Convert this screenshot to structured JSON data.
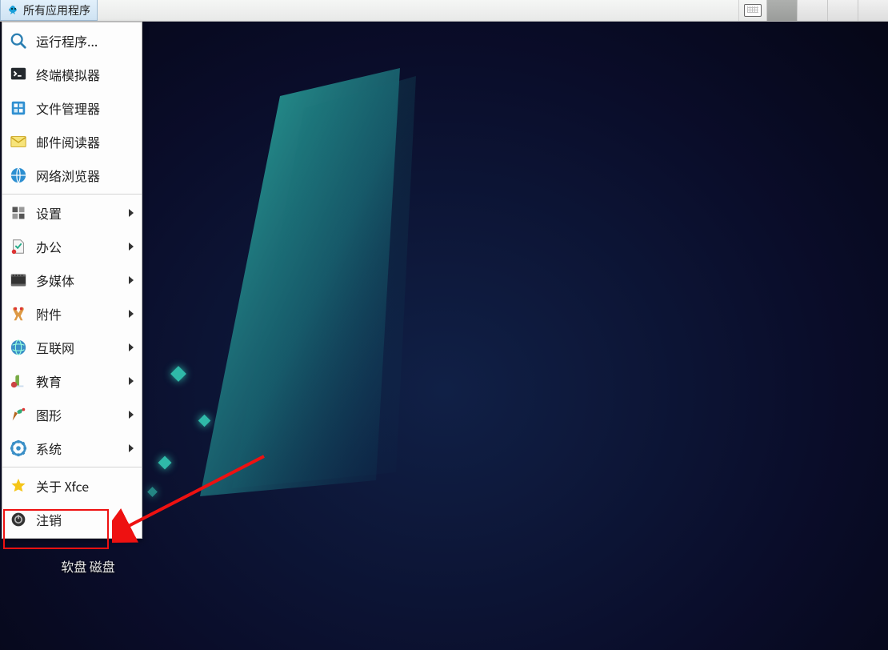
{
  "panel": {
    "app_menu_label": "所有应用程序"
  },
  "menu": {
    "run": "运行程序...",
    "terminal": "终端模拟器",
    "filemgr": "文件管理器",
    "mail": "邮件阅读器",
    "browser": "网络浏览器",
    "settings": "设置",
    "office": "办公",
    "multimedia": "多媒体",
    "accessories": "附件",
    "internet": "互联网",
    "education": "教育",
    "graphics": "图形",
    "system": "系统",
    "about": "关于 Xfce",
    "logout": "注销"
  },
  "desktop": {
    "floppy_label": "软盘 磁盘"
  }
}
